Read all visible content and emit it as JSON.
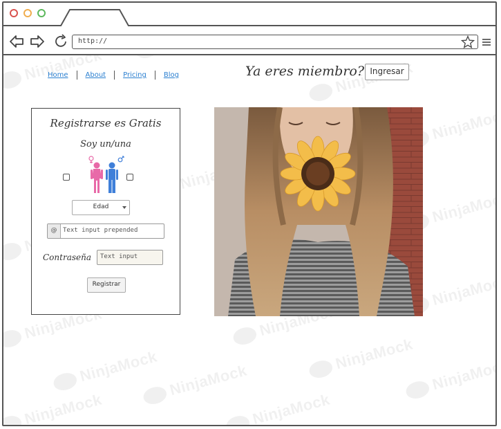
{
  "browser": {
    "url": "http://",
    "dots": [
      {
        "color": "#d9534f"
      },
      {
        "color": "#f0ad4e"
      },
      {
        "color": "#5cb85c"
      }
    ]
  },
  "nav": {
    "items": [
      {
        "label": "Home"
      },
      {
        "label": "About"
      },
      {
        "label": "Pricing"
      },
      {
        "label": "Blog"
      }
    ],
    "link_color": "#2a7fd0"
  },
  "header": {
    "member_text": "Ya eres miembro?",
    "login_label": "Ingresar"
  },
  "form": {
    "title": "Registrarse es Gratis",
    "gender_prompt": "Soy un/una",
    "female_color": "#e86aa8",
    "male_color": "#3f7fd9",
    "age_select": "Edad",
    "email_placeholder": "Text input prepended",
    "email_addon": "@",
    "password_label": "Contraseña",
    "password_placeholder": "Text input",
    "submit_label": "Registrar"
  },
  "watermark": {
    "text": "NinjaMock"
  }
}
